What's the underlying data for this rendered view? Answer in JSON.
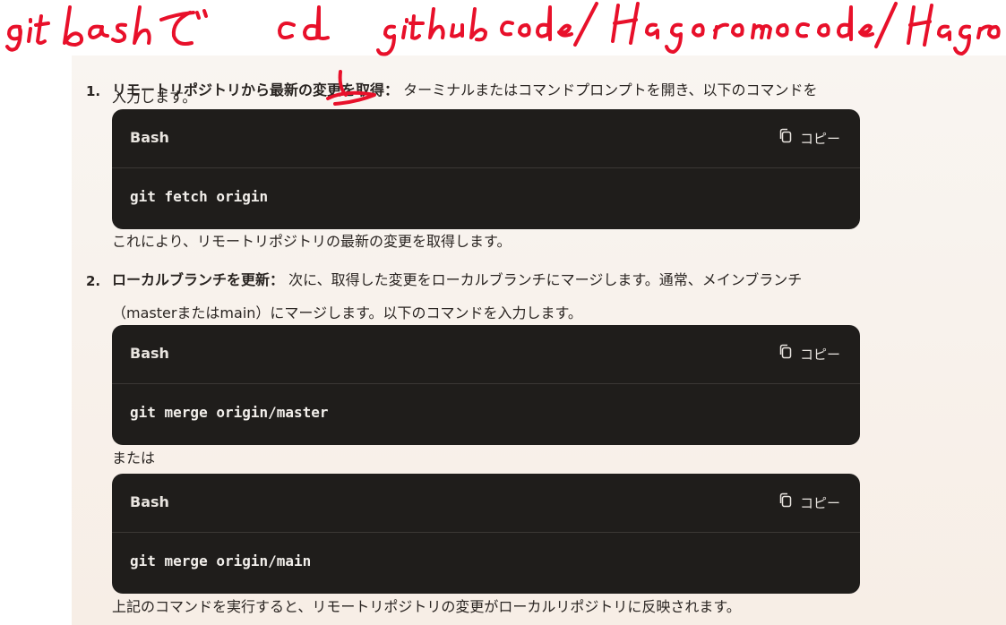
{
  "annotation": {
    "text": "git bashで cd github code/ Hagoromo code/ Hagoromo",
    "color": "#e8102a"
  },
  "steps": [
    {
      "number": "1.",
      "title": "リモートリポジトリから最新の変更を取得",
      "colon": "：",
      "desc_line1": "ターミナルまたはコマンドプロンプトを開き、以下のコマンドを",
      "desc_line2": "入力します。",
      "code_lang": "Bash",
      "copy_label": "コピー",
      "code": "git fetch origin",
      "after": "これにより、リモートリポジトリの最新の変更を取得します。"
    },
    {
      "number": "2.",
      "title": "ローカルブランチを更新",
      "colon": "：",
      "desc_line1": "次に、取得した変更をローカルブランチにマージします。通常、メインブランチ",
      "desc_line2": "（masterまたはmain）にマージします。以下のコマンドを入力します。",
      "code_lang": "Bash",
      "copy_label": "コピー",
      "code": "git merge origin/master",
      "or_text": "または",
      "code2_lang": "Bash",
      "copy2_label": "コピー",
      "code2": "git merge origin/main",
      "after": "上記のコマンドを実行すると、リモートリポジトリの変更がローカルリポジトリに反映されます。"
    }
  ],
  "colors": {
    "code_bg": "#1f1d1b",
    "doc_bg": "#f9f5f1",
    "ink": "#e8102a"
  }
}
